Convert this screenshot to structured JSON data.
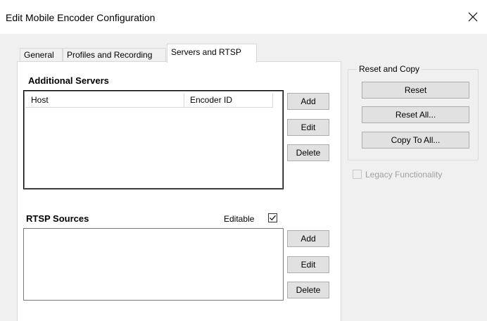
{
  "window": {
    "title": "Edit Mobile Encoder Configuration"
  },
  "tabs": [
    {
      "label": "General"
    },
    {
      "label": "Profiles and Recording"
    },
    {
      "label": "Servers and RTSP"
    }
  ],
  "additional_servers": {
    "title": "Additional Servers",
    "columns": [
      "Host",
      "Encoder ID"
    ],
    "rows": [],
    "buttons": {
      "add": "Add",
      "edit": "Edit",
      "delete": "Delete"
    }
  },
  "rtsp_sources": {
    "title": "RTSP Sources",
    "editable_label": "Editable",
    "editable_checked": true,
    "rows": [],
    "buttons": {
      "add": "Add",
      "edit": "Edit",
      "delete": "Delete"
    }
  },
  "reset_and_copy": {
    "title": "Reset and Copy",
    "reset": "Reset",
    "reset_all": "Reset All...",
    "copy_to_all": "Copy To All..."
  },
  "legacy": {
    "label": "Legacy Functionality",
    "checked": false,
    "enabled": false
  }
}
